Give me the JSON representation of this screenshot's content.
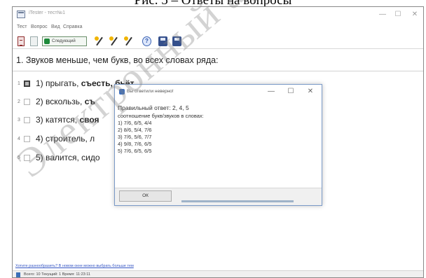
{
  "caption": "Рис. 5 – Ответы на вопросы",
  "window": {
    "title": "iTester - тест№1",
    "controls": {
      "minimize": "—",
      "maximize": "☐",
      "close": "✕"
    }
  },
  "menu": [
    "Тест",
    "Вопрос",
    "Вид",
    "Справка"
  ],
  "toolbar": {
    "next_label": "Следующий",
    "help_label": "?"
  },
  "question": "1. Звуков меньше, чем букв, во всех словах ряда:",
  "answers": [
    {
      "num": "1",
      "text": "1) прыгать, ",
      "bold": "съесть, бьёт",
      "checked": true
    },
    {
      "num": "2",
      "text": "2) вскользь, ",
      "bold": "съ",
      "checked": false
    },
    {
      "num": "3",
      "text": "3) катятся, ",
      "bold": "своя",
      "checked": false
    },
    {
      "num": "4",
      "text": "4) строитель, л",
      "bold": "",
      "checked": false
    },
    {
      "num": "5",
      "text": "5) валится, сидо",
      "bold": "",
      "checked": false
    }
  ],
  "dialog": {
    "title": "Вы ответили неверно!",
    "controls": {
      "minimize": "—",
      "maximize": "☐",
      "close": "✕"
    },
    "correct": "Правильный ответ: 2, 4, 5",
    "subtitle": "соотношение букв/звуков в словах:",
    "rows": [
      "1) 7/6, 6/5, 4/4",
      "2) 8/6, 5/4, 7/6",
      "3) 7/6, 5/6, 7/7",
      "4) 9/8, 7/6, 6/5",
      "5) 7/6, 6/5, 6/5"
    ],
    "ok_label": "ОК"
  },
  "status": {
    "link": "Хотите разнообразить? В новом окне можно выбрать больше тем",
    "text": "Всего: 10   Текущий: 1   Время: 11:23:11"
  },
  "watermark": "Электронный архив"
}
